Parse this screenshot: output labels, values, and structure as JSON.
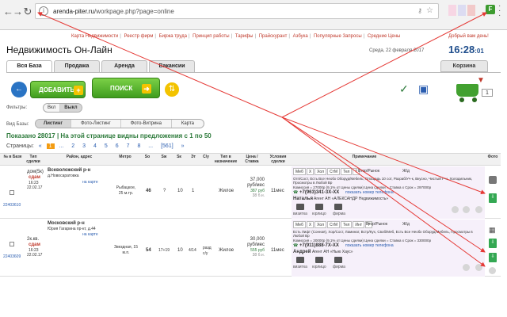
{
  "browser": {
    "url_host": "arenda-piter.ru",
    "url_path": "/workpage.php?page=online",
    "ext_icon": "F",
    "icons": [
      "back-icon",
      "forward-icon",
      "reload-icon",
      "info-icon",
      "key-icon",
      "star-icon",
      "extension-icon",
      "menu-icon"
    ]
  },
  "topnav": {
    "items": [
      "Карта Недвижимости",
      "Реестр фирм",
      "Биржа труда",
      "Принцип работы",
      "Тарифы",
      "Прайскурант",
      "Азбука",
      "Популярные Запросы",
      "Средние Цены"
    ],
    "welcome": "Добрый вам день!"
  },
  "header": {
    "title": "Недвижимость Он-Лайн",
    "date": "Среда, 22 февраля 2017",
    "time": "16:28",
    "seconds": ":01"
  },
  "tabs": [
    "Вся База",
    "Продажа",
    "Аренда",
    "Вакансии"
  ],
  "basket_tab": "Корзина",
  "actions": {
    "add": "ДОБАВИТЬ",
    "search": "ПОИСК",
    "cart_count": "1"
  },
  "filters": {
    "label": "Фильтры:",
    "options": [
      "Вкл",
      "Выкл"
    ],
    "selected": "Выкл"
  },
  "view": {
    "label": "Вид Базы:",
    "options": [
      "Листинг",
      "Фото-Листинг",
      "Фото-Витрина",
      "Карта"
    ],
    "selected": "Листинг"
  },
  "results": {
    "shown_label": "Показано",
    "shown_count": "28017",
    "page_text": "На этой странице видны предложения с",
    "range_from": "1",
    "range_sep": "по",
    "range_to": "50"
  },
  "pagination": {
    "label": "Страницы:",
    "items": [
      "«",
      "1",
      "...",
      "2",
      "3",
      "4",
      "5",
      "6",
      "7",
      "8",
      "...",
      "[561]",
      "»"
    ],
    "current": "1"
  },
  "table": {
    "headers": [
      "№ в Базе",
      "Тип сделки",
      "Район, адрес",
      "Метро",
      "So",
      "Sж",
      "Sк",
      "Эт",
      "С/у",
      "Тип в назначение",
      "Цена / Ставка",
      "Условия сделки",
      "Примечание",
      "Фото"
    ],
    "rows": [
      {
        "id": "22403610",
        "deal": "дом(5к)",
        "deal2": "сдам",
        "time": "16:23",
        "date": "22.02.17",
        "district": "Всеволожский р-н",
        "address": "д.Новосаратовка",
        "map_link": "на карте",
        "metro": "Рыбацкое, 25 м.тр.",
        "so": "46",
        "szh": "?",
        "sk": "10",
        "floor": "1",
        "su": "",
        "purpose": "Жилое",
        "price": "37,000 руб/мес",
        "price_extra": "387 руб",
        "price_extra2": "38 б.н.",
        "terms": "11мес",
        "tags": [
          "Меб",
          "Х",
          "Хол",
          "СтМ",
          "Тел",
          "Т"
        ],
        "note_type": "Втор/Рынок",
        "note_cond": "Ж/д",
        "note_text": "Отп/Сост, Есть Все Необх Оборуд/Мебель, Площадь 10 сот, Разраб/Уч-к, Вкусно, Чистый Р-н, Холодильник, Просмотры в Любой Вр",
        "commission": "Комиссия = 27000р (9,1% от Цены сделки) Цена сделки = Ставка х Срок = 297000р",
        "phone": "+7(963)341-3X-XX",
        "phone_link": "показать номер телефона",
        "agent": "Наталья",
        "agency": "Агент АН «АЛЕКСАНДР Недвижимость»",
        "agent_icons": [
          "визитка",
          "юрлицо",
          "фирма"
        ]
      },
      {
        "id": "22403609",
        "deal": "2к.кв.",
        "deal2": "сдам",
        "time": "16:23",
        "date": "22.02.17",
        "district": "Московский р-н",
        "address": "Юрия Гагарина пр-кт, д.44",
        "map_link": "на карте",
        "metro": "Звездная, 15 м.п.",
        "so": "54",
        "szh": "17+19",
        "sk": "10",
        "floor": "4/14",
        "su": "разд с/у",
        "purpose": "Жилое",
        "price": "30,000 руб/мес",
        "price_extra": "555 руб",
        "price_extra2": "38 б.н.",
        "terms": "11мес",
        "tags": [
          "Меб",
          "Х",
          "Хол",
          "СтМ",
          "Тел",
          "Инт",
          "Т"
        ],
        "note_type": "Втор/Рынок",
        "note_cond": "Ж/д",
        "note_text": "Есть Лифт (Сонная), Хор/Сост, Ламинат, Встр/Кух, Своб/Меб, Есть Все Необх Оборуд/Мебель, Просмотры в Любой Вр",
        "commission": "Комиссия = 30000р (9,1% от Цены сделки) Цена сделки = Ставка х Срок = 330000р",
        "phone": "+7(911)888-7X-XX",
        "phone_link": "показать номер телефона",
        "agent": "Андрей",
        "agency": "Агент АН «Ныю Хаус»",
        "agent_icons": [
          "визитка",
          "юрлицо",
          "фирма"
        ]
      }
    ]
  },
  "colors": {
    "accent_green": "#3f9d1e",
    "link_red": "#c0392b",
    "link_blue": "#2a5db0",
    "clock_blue": "#1f4e8c",
    "annotation_red": "#e53935"
  }
}
